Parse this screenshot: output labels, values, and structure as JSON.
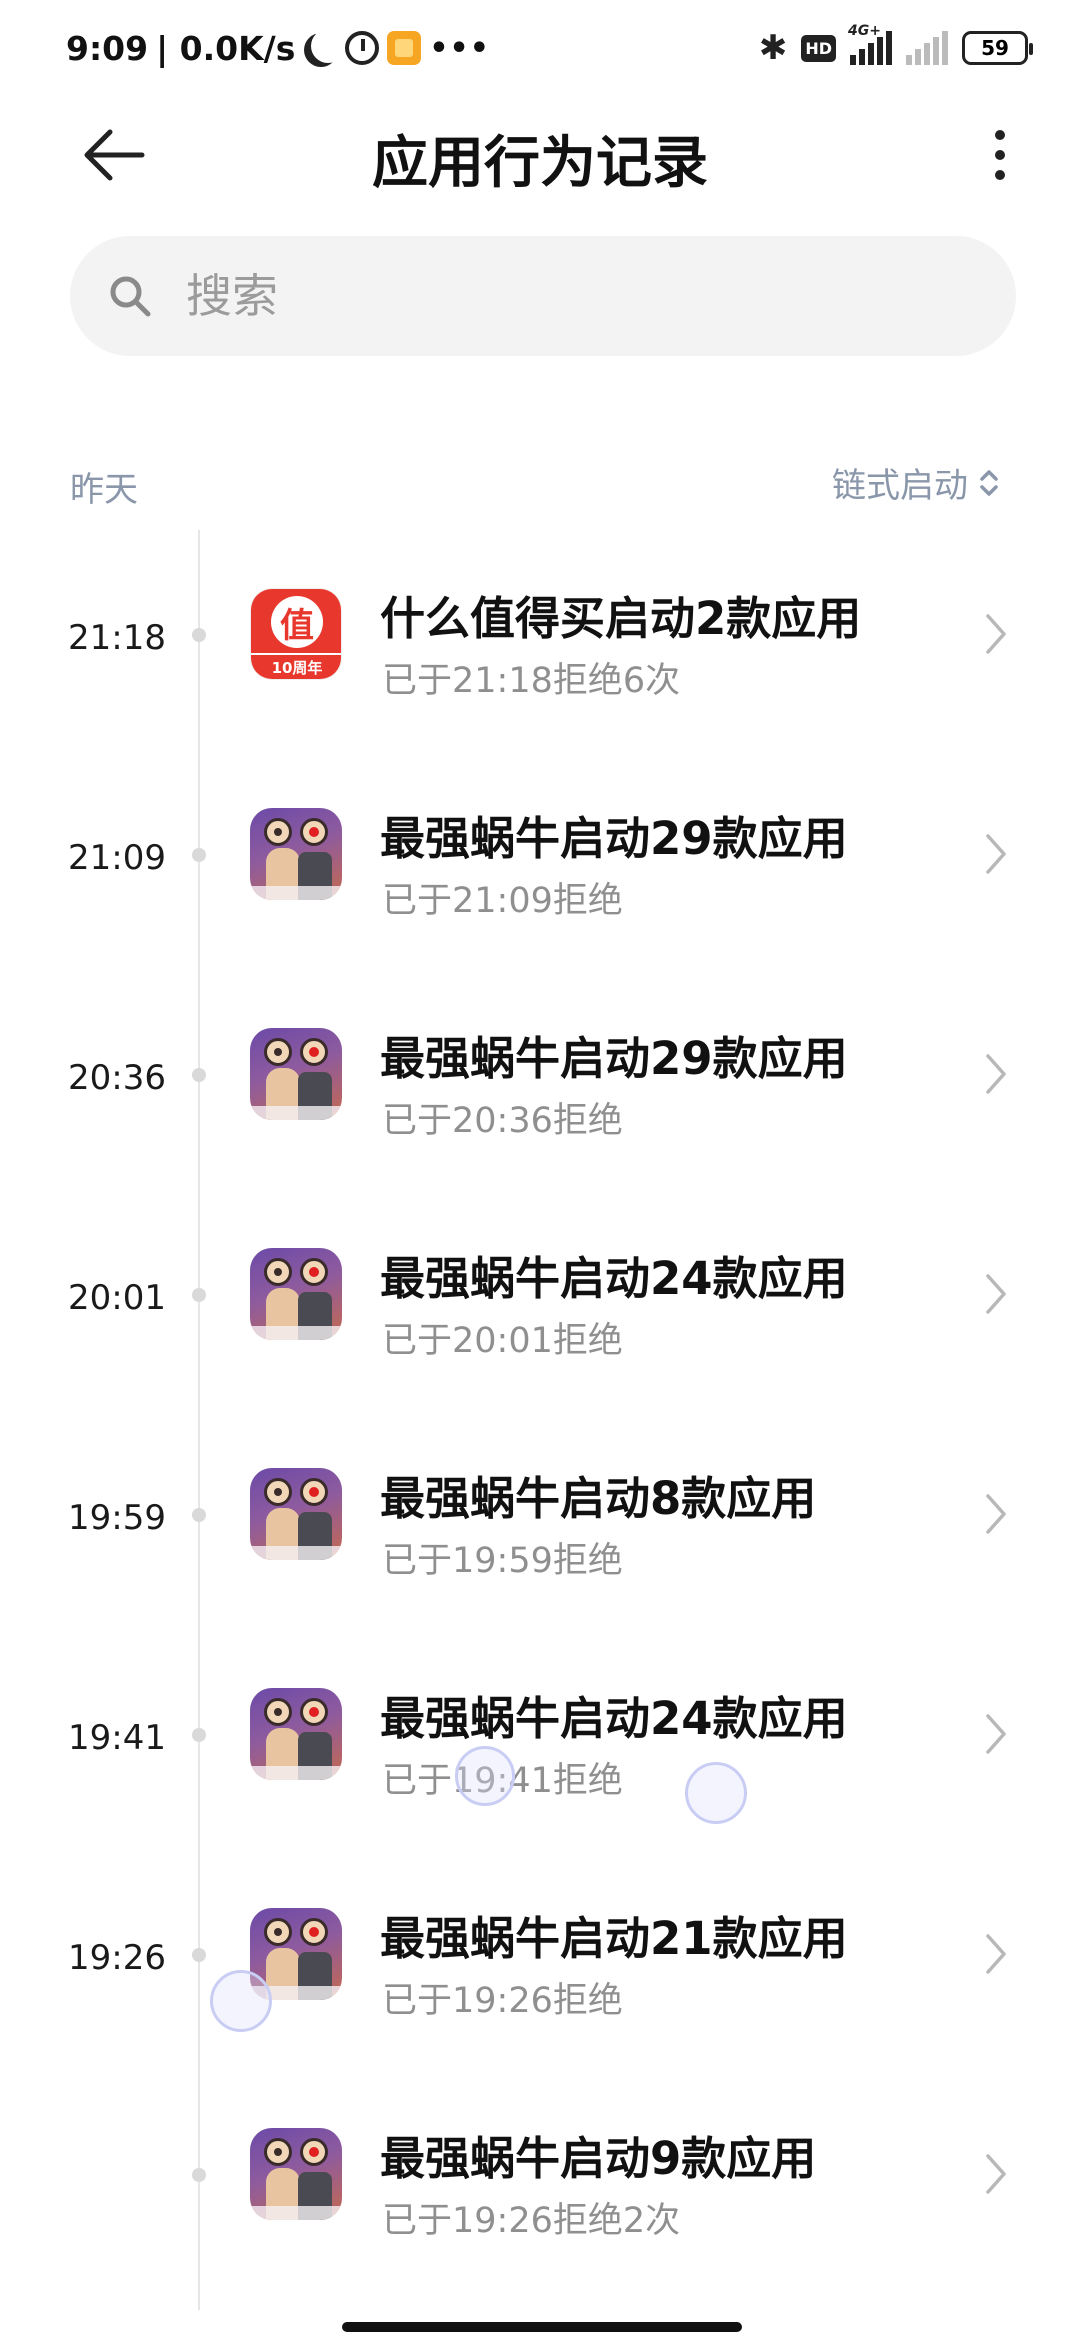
{
  "status_bar": {
    "time": "9:09",
    "net_speed": "| 0.0K/s",
    "more": "•••",
    "bt": "✱",
    "hd": "HD",
    "net_type": "4G+",
    "battery": "59"
  },
  "header": {
    "title": "应用行为记录"
  },
  "search": {
    "placeholder": "搜索"
  },
  "section": {
    "date": "昨天",
    "sort_label": "链式启动"
  },
  "records": [
    {
      "time": "21:18",
      "app": "什么值得买",
      "icon": "smzdm-icon",
      "icon_label": "10周年",
      "icon_char": "值",
      "title": "什么值得买启动2款应用",
      "subtitle": "已于21:18拒绝6次"
    },
    {
      "time": "21:09",
      "app": "最强蜗牛",
      "icon": "snail-icon",
      "title": "最强蜗牛启动29款应用",
      "subtitle": "已于21:09拒绝"
    },
    {
      "time": "20:36",
      "app": "最强蜗牛",
      "icon": "snail-icon",
      "title": "最强蜗牛启动29款应用",
      "subtitle": "已于20:36拒绝"
    },
    {
      "time": "20:01",
      "app": "最强蜗牛",
      "icon": "snail-icon",
      "title": "最强蜗牛启动24款应用",
      "subtitle": "已于20:01拒绝"
    },
    {
      "time": "19:59",
      "app": "最强蜗牛",
      "icon": "snail-icon",
      "title": "最强蜗牛启动8款应用",
      "subtitle": "已于19:59拒绝"
    },
    {
      "time": "19:41",
      "app": "最强蜗牛",
      "icon": "snail-icon",
      "title": "最强蜗牛启动24款应用",
      "subtitle": "已于19:41拒绝"
    },
    {
      "time": "19:26",
      "app": "最强蜗牛",
      "icon": "snail-icon",
      "title": "最强蜗牛启动21款应用",
      "subtitle": "已于19:26拒绝"
    },
    {
      "time": "",
      "app": "最强蜗牛",
      "icon": "snail-icon",
      "title": "最强蜗牛启动9款应用",
      "subtitle": "已于19:26拒绝2次"
    }
  ],
  "colors": {
    "accent_muted": "#8a96aa",
    "smzdm_red": "#e8372c",
    "search_bg": "#f3f3f3"
  }
}
